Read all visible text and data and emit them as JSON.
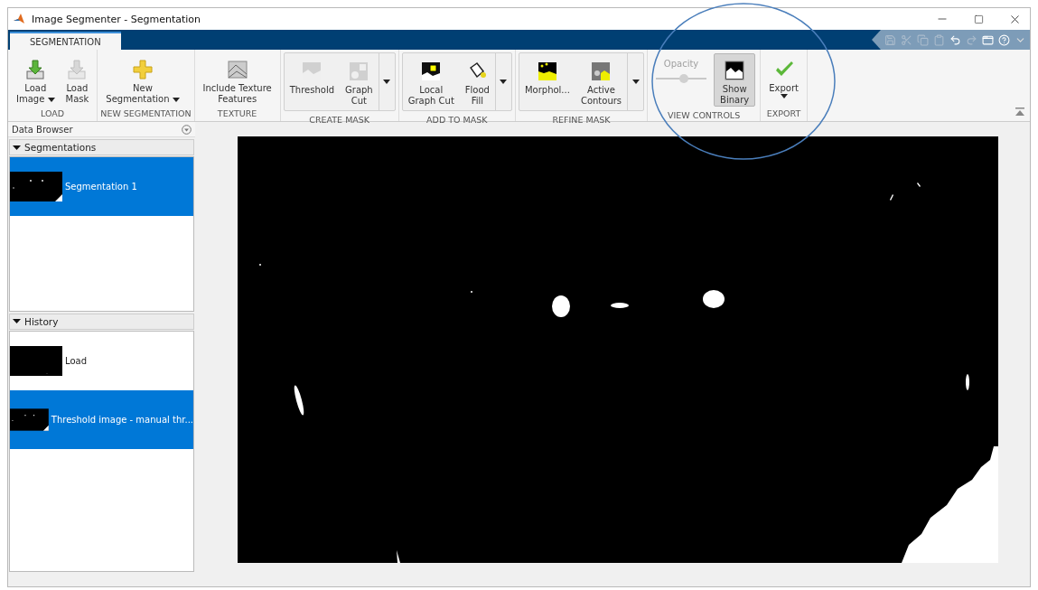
{
  "window": {
    "title": "Image Segmenter - Segmentation"
  },
  "tabs": [
    {
      "label": "SEGMENTATION",
      "selected": true
    }
  ],
  "ribbon": {
    "groups": [
      {
        "title": "LOAD",
        "framed": false,
        "items": [
          {
            "kind": "button",
            "label": [
              "Load",
              "Image"
            ],
            "menu": true
          },
          {
            "kind": "button",
            "label": [
              "Load",
              "Mask"
            ],
            "menu": false
          }
        ]
      },
      {
        "title": "NEW SEGMENTATION",
        "framed": false,
        "items": [
          {
            "kind": "button",
            "label": [
              "New",
              "Segmentation"
            ],
            "menu": true
          }
        ]
      },
      {
        "title": "TEXTURE",
        "framed": false,
        "items": [
          {
            "kind": "button",
            "label": [
              "Include Texture",
              "Features"
            ],
            "menu": false
          }
        ]
      },
      {
        "title": "CREATE MASK",
        "framed": true,
        "items": [
          {
            "kind": "button",
            "label": [
              "Threshold"
            ],
            "menu": false
          },
          {
            "kind": "button",
            "label": [
              "Graph",
              "Cut"
            ],
            "menu": false
          }
        ]
      },
      {
        "title": "ADD TO MASK",
        "framed": true,
        "items": [
          {
            "kind": "button",
            "label": [
              "Local",
              "Graph Cut"
            ],
            "menu": false
          },
          {
            "kind": "button",
            "label": [
              "Flood",
              "Fill"
            ],
            "menu": false
          }
        ]
      },
      {
        "title": "REFINE MASK",
        "framed": true,
        "items": [
          {
            "kind": "button",
            "label": [
              "Morphol..."
            ],
            "menu": false
          },
          {
            "kind": "button",
            "label": [
              "Active",
              "Contours"
            ],
            "menu": false
          }
        ]
      },
      {
        "title": "VIEW CONTROLS",
        "framed": false,
        "items": [
          {
            "kind": "slider",
            "label": "Opacity",
            "disabled": true,
            "level": 0.55
          },
          {
            "kind": "toggle",
            "label": [
              "Show",
              "Binary"
            ],
            "pressed": true
          }
        ]
      },
      {
        "title": "EXPORT",
        "framed": false,
        "items": [
          {
            "kind": "button",
            "label": [
              "Export"
            ],
            "menu": true
          }
        ]
      }
    ]
  },
  "data_browser": {
    "title": "Data Browser",
    "sections": [
      {
        "title": "Segmentations",
        "expanded": true,
        "items": [
          {
            "label": "Segmentation 1",
            "selected": true
          }
        ]
      },
      {
        "title": "History",
        "expanded": true,
        "items": [
          {
            "label": "Load",
            "selected": false
          },
          {
            "label": "Threshold image - manual thr...",
            "selected": true
          }
        ]
      }
    ]
  }
}
